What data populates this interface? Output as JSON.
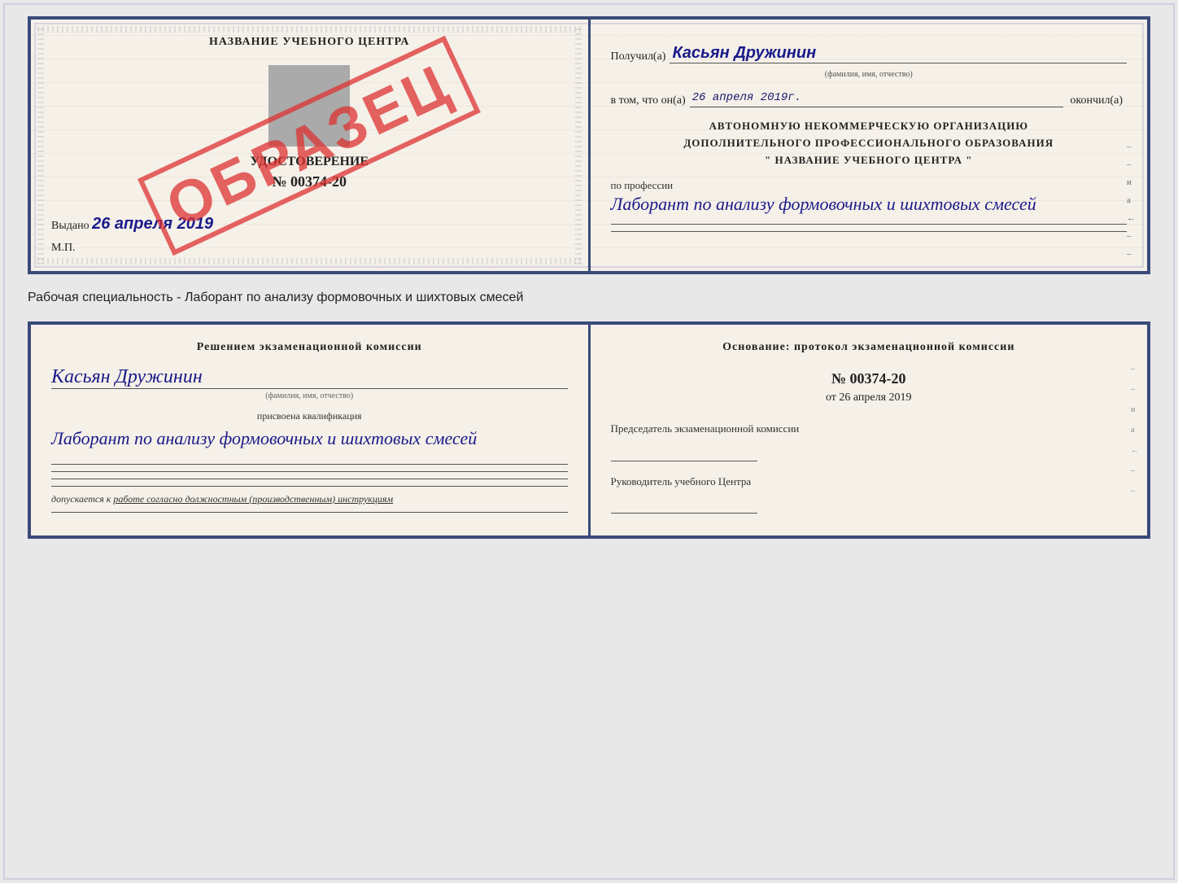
{
  "top_certificate": {
    "left": {
      "title": "НАЗВАНИЕ УЧЕБНОГО ЦЕНТРА",
      "subtitle": "УДОСТОВЕРЕНИЕ",
      "number": "№ 00374-20",
      "issued_label": "Выдано",
      "issued_date": "26 апреля 2019",
      "mp_label": "М.П.",
      "stamp": "ОБРАЗЕЦ"
    },
    "right": {
      "received_label": "Получил(а)",
      "received_name": "Касьян Дружинин",
      "name_subtitle": "(фамилия, имя, отчество)",
      "completed_prefix": "в том, что он(а)",
      "completed_date": "26 апреля 2019г.",
      "completed_suffix": "окончил(а)",
      "org_line1": "АВТОНОМНУЮ НЕКОММЕРЧЕСКУЮ ОРГАНИЗАЦИЮ",
      "org_line2": "ДОПОЛНИТЕЛЬНОГО ПРОФЕССИОНАЛЬНОГО ОБРАЗОВАНИЯ",
      "org_line3": "\"  НАЗВАНИЕ УЧЕБНОГО ЦЕНТРА  \"",
      "profession_label": "по профессии",
      "profession_value": "Лаборант по анализу формовочных и шихтовых смесей",
      "right_chars": [
        "–",
        "–",
        "и",
        "а",
        "←",
        "–",
        "–"
      ]
    }
  },
  "specialty_label": "Рабочая специальность - Лаборант по анализу формовочных и шихтовых смесей",
  "bottom_certificate": {
    "left": {
      "title": "Решением экзаменационной комиссии",
      "name": "Касьян Дружинин",
      "name_subtitle": "(фамилия, имя, отчество)",
      "qualification_label": "присвоена квалификация",
      "qualification_value": "Лаборант по анализу формовочных и шихтовых смесей",
      "admission_prefix": "допускается к",
      "admission_text": "работе согласно должностным (производственным) инструкциям"
    },
    "right": {
      "title": "Основание: протокол экзаменационной комиссии",
      "number": "№ 00374-20",
      "date_prefix": "от",
      "date": "26 апреля 2019",
      "chairman_title": "Председатель экзаменационной комиссии",
      "director_title": "Руководитель учебного Центра",
      "right_chars": [
        "–",
        "–",
        "и",
        "а",
        "←",
        "–",
        "–"
      ]
    }
  }
}
